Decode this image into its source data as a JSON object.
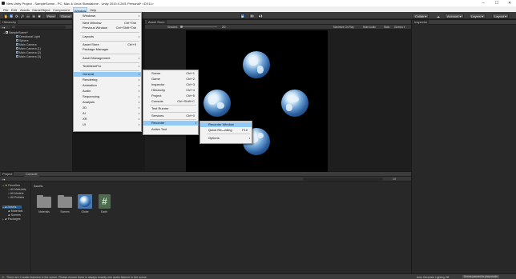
{
  "title_bar": {
    "title": "New Unity Project - SampleScene - PC, Mac & Linux Standalone - Unity 2019.4.24f1 Personal* <DX11>",
    "minimize": "–",
    "maximize": "☐",
    "close": "✕"
  },
  "menubar": {
    "items": [
      "File",
      "Edit",
      "Assets",
      "GameObject",
      "Component",
      "Window",
      "Help"
    ]
  },
  "toolbar": {
    "tools": [
      "✋",
      "✥",
      "⟳",
      "⤢",
      "▭",
      "⊕",
      "✱"
    ],
    "pivot": "Pivot",
    "global": "Global",
    "play": "▶",
    "pause": "❚❚",
    "step": "▶❚",
    "collab": "Collab ▾",
    "account": "Account ▾",
    "layers": "Layers ▾",
    "layout": "Layout ▾"
  },
  "hierarchy": {
    "tab": "Hierarchy",
    "search_placeholder": "All",
    "scene": "SampleScene*",
    "items": [
      "Directional Light",
      "Sphere",
      "Main Camera",
      "Main Camera (1)",
      "Main Camera (2)",
      "Main Camera (3)"
    ]
  },
  "window_menu": {
    "items": [
      {
        "label": "Windows",
        "shortcut": "",
        "sub": true
      },
      {
        "label": "Next Window",
        "shortcut": "Ctrl+Tab",
        "sub": false
      },
      {
        "label": "Previous Window",
        "shortcut": "Ctrl+Shift+Tab",
        "sub": false
      },
      {
        "label": "Layouts",
        "shortcut": "",
        "sub": true
      },
      {
        "label": "Asset Store",
        "shortcut": "Ctrl+9",
        "sub": false
      },
      {
        "label": "Package Manager",
        "shortcut": "",
        "sub": false
      },
      {
        "label": "Asset Management",
        "shortcut": "",
        "sub": true
      },
      {
        "label": "TextMeshPro",
        "shortcut": "",
        "sub": true
      },
      {
        "label": "General",
        "shortcut": "",
        "sub": true
      },
      {
        "label": "Rendering",
        "shortcut": "",
        "sub": true
      },
      {
        "label": "Animation",
        "shortcut": "",
        "sub": true
      },
      {
        "label": "Audio",
        "shortcut": "",
        "sub": true
      },
      {
        "label": "Sequencing",
        "shortcut": "",
        "sub": true
      },
      {
        "label": "Analysis",
        "shortcut": "",
        "sub": true
      },
      {
        "label": "2D",
        "shortcut": "",
        "sub": true
      },
      {
        "label": "AI",
        "shortcut": "",
        "sub": true
      },
      {
        "label": "XR",
        "shortcut": "",
        "sub": true
      },
      {
        "label": "UI",
        "shortcut": "",
        "sub": true
      }
    ]
  },
  "general_menu": {
    "items": [
      {
        "label": "Scene",
        "shortcut": "Ctrl+1"
      },
      {
        "label": "Game",
        "shortcut": "Ctrl+2"
      },
      {
        "label": "Inspector",
        "shortcut": "Ctrl+3"
      },
      {
        "label": "Hierarchy",
        "shortcut": "Ctrl+4"
      },
      {
        "label": "Project",
        "shortcut": "Ctrl+5"
      },
      {
        "label": "Console",
        "shortcut": "Ctrl+Shift+C"
      },
      {
        "label": "Test Runner",
        "shortcut": ""
      },
      {
        "label": "Services",
        "shortcut": "Ctrl+0"
      },
      {
        "label": "Recorder",
        "shortcut": ""
      },
      {
        "label": "Active Tool",
        "shortcut": ""
      }
    ]
  },
  "recorder_menu": {
    "items": [
      {
        "label": "Recorder Window",
        "shortcut": ""
      },
      {
        "label": "Quick Recording",
        "shortcut": "F10"
      },
      {
        "label": "Options",
        "shortcut": ""
      }
    ]
  },
  "scene_view": {
    "tab": "Asset Store",
    "shading": "Shaded",
    "mode": "2D",
    "toolbar_right": [
      "Maximize On Play",
      "Mute Audio",
      "Stats",
      "Gizmos ▾"
    ]
  },
  "inspector": {
    "tab": "Inspector"
  },
  "project": {
    "tabs": [
      "Project",
      "Console"
    ],
    "favorites_label": "Favorites",
    "favorites": [
      "All Materials",
      "All Models",
      "All Prefabs"
    ],
    "assets_label": "Assets",
    "asset_tree": [
      "Materials",
      "Scenes"
    ],
    "packages_label": "Packages",
    "breadcrumb": "Assets",
    "assets": [
      {
        "name": "Materials",
        "kind": "folder"
      },
      {
        "name": "Scenes",
        "kind": "folder"
      },
      {
        "name": "Globe",
        "kind": "image"
      },
      {
        "name": "Earth",
        "kind": "script"
      }
    ],
    "count_label": "14"
  },
  "status_bar": {
    "message": "There are 4 audio listeners in the scene. Please ensure there is always exactly one audio listener in the scene.",
    "lighting": "Auto Generate Lighting Off",
    "state": "Scene paused in play mode"
  },
  "colors": {
    "highlight": "#91c9f7",
    "play_active": "#4d80c4",
    "panel": "#282828"
  }
}
